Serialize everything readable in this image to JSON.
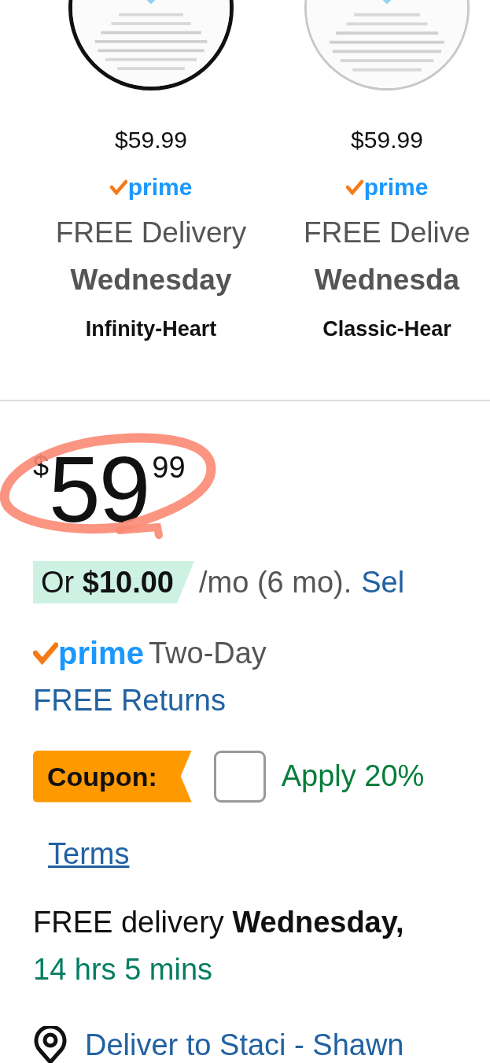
{
  "swatches": [
    {
      "price": "$59.99",
      "prime": "prime",
      "delivery": "FREE Delivery",
      "day": "Wednesday",
      "name": "Infinity-Heart",
      "selected": true
    },
    {
      "price": "$59.99",
      "prime": "prime",
      "delivery": "FREE Delive",
      "day": "Wednesda",
      "name": "Classic-Hear",
      "selected": false
    }
  ],
  "price": {
    "symbol": "$",
    "whole": "59",
    "fraction": "99"
  },
  "installment": {
    "badge": "Or **$10.00**",
    "text": "/mo (6 mo).",
    "link": "Sel"
  },
  "prime_delivery": {
    "logo": "prime",
    "speed": "Two-Day"
  },
  "returns_link": "FREE Returns",
  "coupon": {
    "label": "Coupon:",
    "checked": false,
    "text": "Apply 20%"
  },
  "terms_link": "Terms",
  "delivery": {
    "text": "FREE delivery **Wednesday,**",
    "countdown": "14 hrs 5 mins"
  },
  "deliver_to": "Deliver to Staci - Shawn"
}
